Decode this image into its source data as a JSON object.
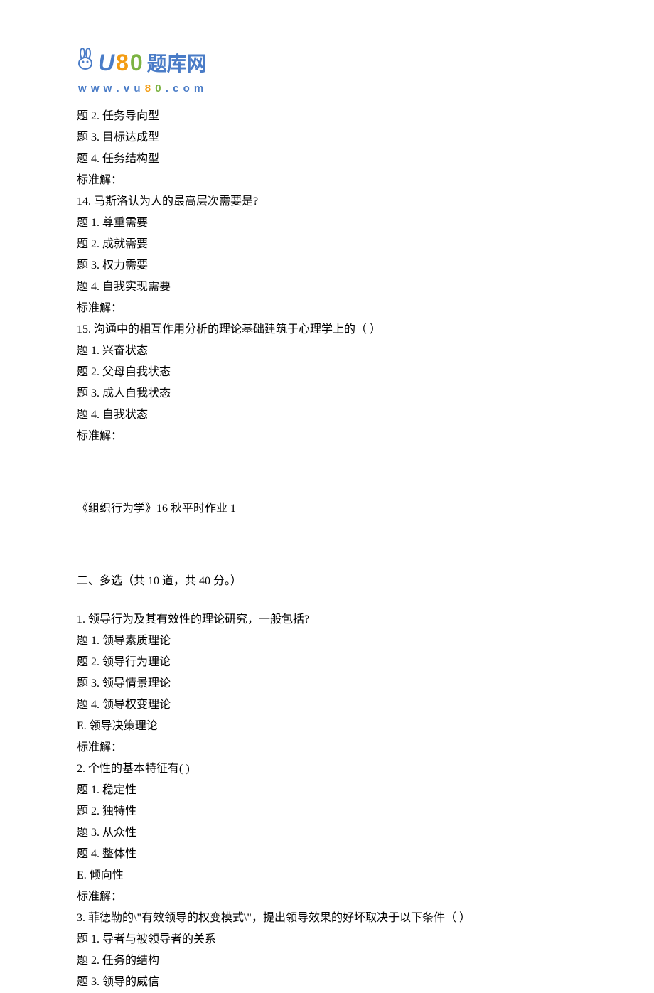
{
  "logo": {
    "brand_text": "题库网",
    "url_text": "www.vu80.com"
  },
  "q13_remainder": {
    "opt2": "题 2.  任务导向型",
    "opt3": "题 3.  目标达成型",
    "opt4": "题 4.  任务结构型",
    "answer_label": "标准解："
  },
  "q14": {
    "stem": "14.    马斯洛认为人的最高层次需要是?",
    "opt1": "题 1.  尊重需要",
    "opt2": "题 2.  成就需要",
    "opt3": "题 3.  权力需要",
    "opt4": "题 4.  自我实现需要",
    "answer_label": "标准解："
  },
  "q15": {
    "stem": "15.    沟通中的相互作用分析的理论基础建筑于心理学上的（       ）",
    "opt1": "题 1.  兴奋状态",
    "opt2": "题 2.  父母自我状态",
    "opt3": "题 3.  成人自我状态",
    "opt4": "题 4.  自我状态",
    "answer_label": "标准解："
  },
  "section_title": "《组织行为学》16 秋平时作业 1",
  "part2_header": "二、多选（共  10  道，共  40  分。）",
  "mq1": {
    "stem": "1.    领导行为及其有效性的理论研究，一般包括?",
    "opt1": "题 1.  领导素质理论",
    "opt2": "题 2.  领导行为理论",
    "opt3": "题 3.  领导情景理论",
    "opt4": "题 4.  领导权变理论",
    "optE": "E.  领导决策理论",
    "answer_label": "标准解："
  },
  "mq2": {
    "stem": "2.    个性的基本特征有( )",
    "opt1": "题 1.  稳定性",
    "opt2": "题 2.  独特性",
    "opt3": "题 3.  从众性",
    "opt4": "题 4.  整体性",
    "optE": "E.  倾向性",
    "answer_label": "标准解："
  },
  "mq3": {
    "stem": "3.    菲德勒的\\\"有效领导的权变模式\\\"，提出领导效果的好坏取决于以下条件（       ）",
    "opt1": "题 1.  导者与被领导者的关系",
    "opt2": "题 2.  任务的结构",
    "opt3": "题 3.  领导的威信"
  }
}
